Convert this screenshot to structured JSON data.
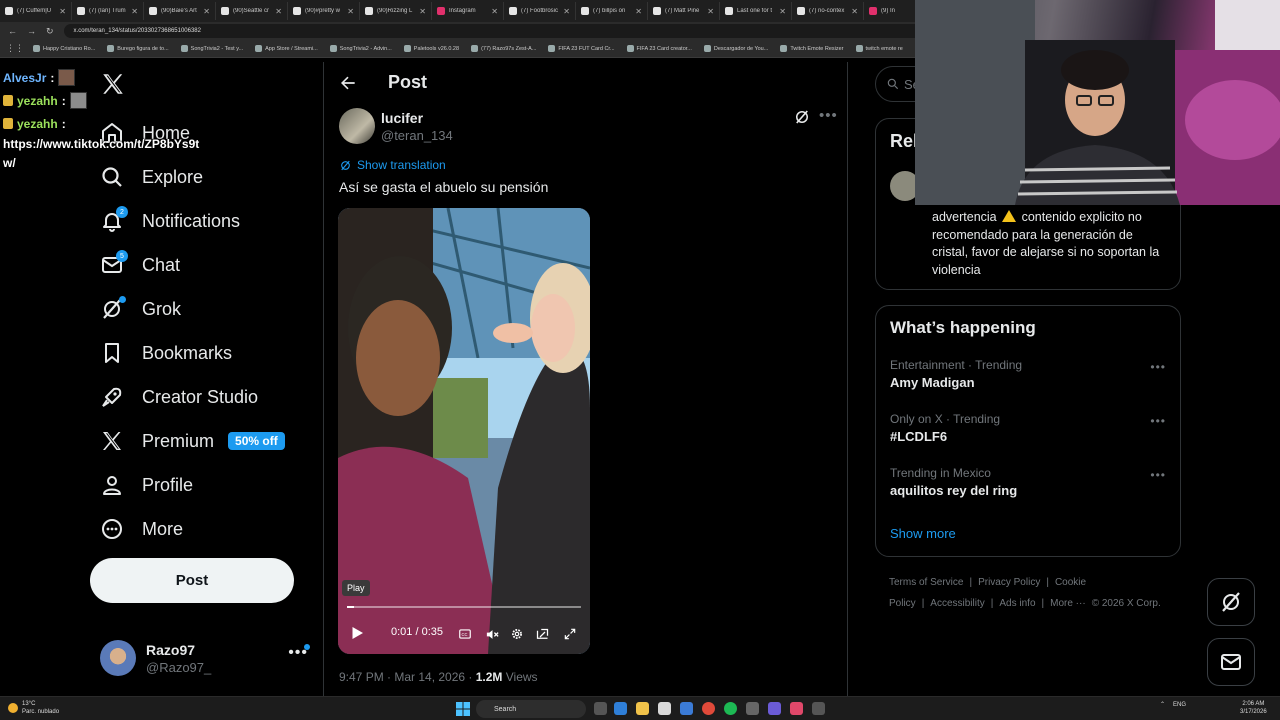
{
  "browser": {
    "tabs": [
      {
        "label": "(7) Cuffem|U",
        "color": "#e5e5e5"
      },
      {
        "label": "(7) (Ian) Trum",
        "color": "#e5e5e5"
      },
      {
        "label": "(90)Baie's Art",
        "color": "#e5e5e5"
      },
      {
        "label": "(90)Seattle cr",
        "color": "#e5e5e5"
      },
      {
        "label": "(90)#pretty w",
        "color": "#e5e5e5"
      },
      {
        "label": "(90)Rizzing L",
        "color": "#e5e5e5"
      },
      {
        "label": "Instagram",
        "color": "#e1306c"
      },
      {
        "label": "(7) Footbrosic",
        "color": "#e5e5e5"
      },
      {
        "label": "(7) billpis on",
        "color": "#e5e5e5"
      },
      {
        "label": "(7) Matt Pine",
        "color": "#e5e5e5"
      },
      {
        "label": "Last one for t",
        "color": "#e5e5e5"
      },
      {
        "label": "(7) no-contex",
        "color": "#e5e5e5"
      },
      {
        "label": "(9) In",
        "color": "#e1306c"
      }
    ],
    "url": "x.com/teran_134/status/2033027368651006382",
    "bookmarks": [
      "Happy Cristiano Ro...",
      "Burego figura de to...",
      "SongTrivia2 - Test y...",
      "App Store / Streami...",
      "SongTrivia2 - Advin...",
      "Paletools v26.0.28",
      "(77) Razo97s Zest-A...",
      "FIFA 23 FUT Card Cr...",
      "FIFA 23 Card creator...",
      "Descargador de You...",
      "Twitch Emote Resizer",
      "twitch emote re"
    ]
  },
  "chat": {
    "line1_user": "AlvesJr",
    "line2_user": "yezahh",
    "line3_user": "yezahh",
    "colon": ":",
    "link": "https://www.tiktok.com/t/ZP8bYs9tw/"
  },
  "nav": {
    "items": [
      {
        "label": "Home",
        "icon": "home-icon"
      },
      {
        "label": "Explore",
        "icon": "search-icon"
      },
      {
        "label": "Notifications",
        "icon": "bell-icon",
        "badge": "2"
      },
      {
        "label": "Chat",
        "icon": "mail-icon",
        "badge": "5"
      },
      {
        "label": "Grok",
        "icon": "grok-icon"
      },
      {
        "label": "Bookmarks",
        "icon": "bookmark-icon"
      },
      {
        "label": "Creator Studio",
        "icon": "rocket-icon"
      },
      {
        "label": "Premium",
        "icon": "x-logo-icon",
        "pill": "50% off"
      },
      {
        "label": "Profile",
        "icon": "person-icon"
      },
      {
        "label": "More",
        "icon": "more-circle-icon"
      }
    ],
    "post_button": "Post",
    "account": {
      "name": "Razo97",
      "handle": "@Razo97_",
      "more": "•••"
    }
  },
  "post": {
    "header_title": "Post",
    "author_name": "lucifer",
    "author_handle": "@teran_134",
    "more": "•••",
    "translate_label": "Show translation",
    "text": "Así se gasta el abuelo su pensión",
    "video": {
      "tooltip": "Play",
      "time": "0:01 / 0:35",
      "progress": 0.03
    },
    "timestamp": "9:47 PM · Mar 14, 2026 · ",
    "views_count": "1.2M",
    "views_label": " Views"
  },
  "right": {
    "search_placeholder": "Se",
    "relevant_title": "Rel",
    "bio_before": "advertencia",
    "bio_after": "contenido explicito no recomendado para la generación de cristal, favor de alejarse si no soportan la violencia",
    "trends_title": "What’s happening",
    "trends": [
      {
        "meta": "Entertainment · Trending",
        "name": "Amy Madigan"
      },
      {
        "meta": "Only on X · Trending",
        "name": "#LCDLF6"
      },
      {
        "meta": "Trending in Mexico",
        "name": "aquilitos rey del ring"
      }
    ],
    "trend_more": "•••",
    "show_more": "Show more",
    "footer": [
      "Terms of Service",
      "|",
      "Privacy Policy",
      "|",
      "Cookie Policy",
      "|",
      "Accessibility",
      "|",
      "Ads info",
      "|",
      "More ···",
      "© 2026 X Corp."
    ]
  },
  "taskbar": {
    "temp": "13°C",
    "weather": "Parc. nublado",
    "search": "Search",
    "lang": "ENG",
    "time": "2:06 AM",
    "date": "3/17/2026"
  },
  "colors": {
    "accent": "#1d9bf0",
    "background": "#000000",
    "border": "#2f3336",
    "muted": "#71767b"
  }
}
